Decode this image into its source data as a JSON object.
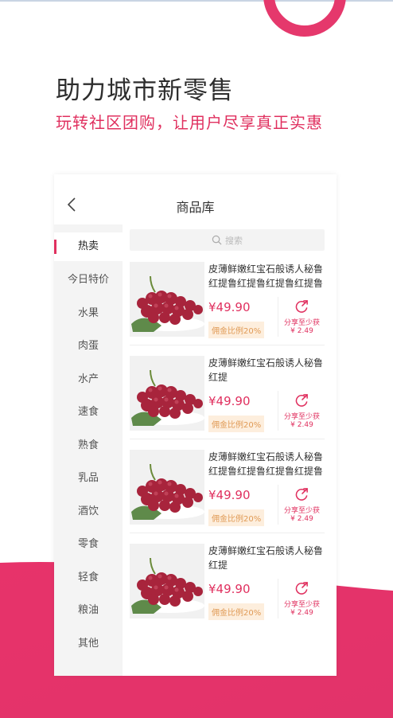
{
  "headline": "助力城市新零售",
  "subline": "玩转社区团购，让用户尽享真正实惠",
  "card": {
    "title": "商品库",
    "search_placeholder": "搜索",
    "categories": [
      "热卖",
      "今日特价",
      "水果",
      "肉蛋",
      "水产",
      "速食",
      "熟食",
      "乳品",
      "酒饮",
      "零食",
      "轻食",
      "粮油",
      "其他"
    ],
    "active_category": "热卖",
    "products": [
      {
        "name": "皮薄鲜嫩红宝石般诱人秘鲁红提鲁红提鲁红提鲁红提鲁红",
        "price": "¥49.90",
        "commission": "佣金比例20%",
        "share_label": "分享至少获",
        "share_amount": "¥ 2.49"
      },
      {
        "name": "皮薄鲜嫩红宝石般诱人秘鲁红提",
        "price": "¥49.90",
        "commission": "佣金比例20%",
        "share_label": "分享至少获",
        "share_amount": "¥ 2.49"
      },
      {
        "name": "皮薄鲜嫩红宝石般诱人秘鲁红提鲁红提鲁红提鲁红提鲁红",
        "price": "¥49.90",
        "commission": "佣金比例20%",
        "share_label": "分享至少获",
        "share_amount": "¥ 2.49"
      },
      {
        "name": "皮薄鲜嫩红宝石般诱人秘鲁红提",
        "price": "¥49.90",
        "commission": "佣金比例20%",
        "share_label": "分享至少获",
        "share_amount": "¥ 2.49"
      }
    ]
  },
  "icons": {
    "back": "chevron-left-icon",
    "search": "search-icon",
    "share": "share-icon",
    "product": "grape-image"
  },
  "colors": {
    "accent": "#e0305f",
    "banner": "#e5386c",
    "commission_bg": "#fdeedd",
    "commission_text": "#e09a55"
  }
}
